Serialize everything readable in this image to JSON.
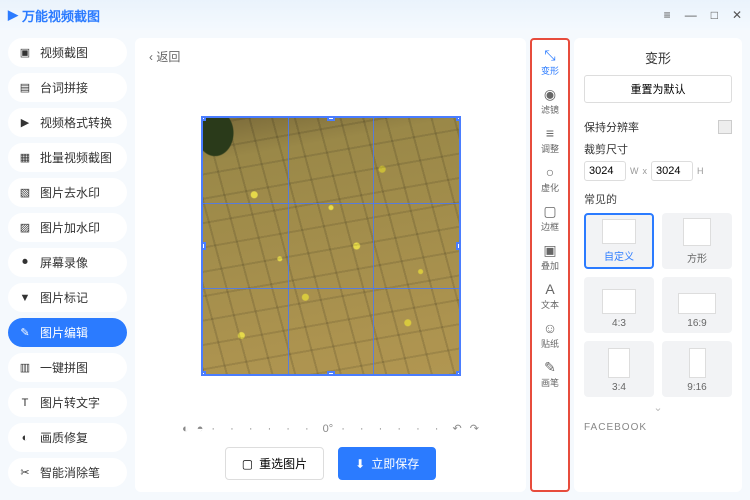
{
  "app": {
    "title": "万能视频截图"
  },
  "window": {
    "menu": "≡",
    "min": "—",
    "max": "□",
    "close": "✕"
  },
  "sidebar": {
    "items": [
      {
        "label": "视频截图",
        "icon": "▣"
      },
      {
        "label": "台词拼接",
        "icon": "▤"
      },
      {
        "label": "视频格式转换",
        "icon": "▶"
      },
      {
        "label": "批量视频截图",
        "icon": "▦"
      },
      {
        "label": "图片去水印",
        "icon": "▧"
      },
      {
        "label": "图片加水印",
        "icon": "▨"
      },
      {
        "label": "屏幕录像",
        "icon": "⏺"
      },
      {
        "label": "图片标记",
        "icon": "▼"
      },
      {
        "label": "图片编辑",
        "icon": "✎"
      },
      {
        "label": "一键拼图",
        "icon": "▥"
      },
      {
        "label": "图片转文字",
        "icon": "T"
      },
      {
        "label": "画质修复",
        "icon": "◐"
      },
      {
        "label": "智能消除笔",
        "icon": "✂"
      }
    ]
  },
  "content": {
    "back": "返回",
    "rotation": "0°",
    "reselect": "重选图片",
    "save": "立即保存"
  },
  "tools": [
    {
      "label": "变形",
      "icon": "⤡"
    },
    {
      "label": "滤镜",
      "icon": "◉"
    },
    {
      "label": "调整",
      "icon": "≡"
    },
    {
      "label": "虚化",
      "icon": "○"
    },
    {
      "label": "边框",
      "icon": "▢"
    },
    {
      "label": "叠加",
      "icon": "▣"
    },
    {
      "label": "文本",
      "icon": "A"
    },
    {
      "label": "贴纸",
      "icon": "☺"
    },
    {
      "label": "画笔",
      "icon": "✎"
    }
  ],
  "panel": {
    "title": "变形",
    "reset": "重置为默认",
    "keep_ratio": "保持分辨率",
    "crop_size_label": "裁剪尺寸",
    "width": "3024",
    "height": "3024",
    "w": "W",
    "x": "x",
    "h": "H",
    "common": "常见的",
    "presets": [
      {
        "label": "自定义"
      },
      {
        "label": "方形"
      },
      {
        "label": "4:3"
      },
      {
        "label": "16:9"
      },
      {
        "label": "3:4"
      },
      {
        "label": "9:16"
      }
    ],
    "facebook": "FACEBOOK"
  }
}
